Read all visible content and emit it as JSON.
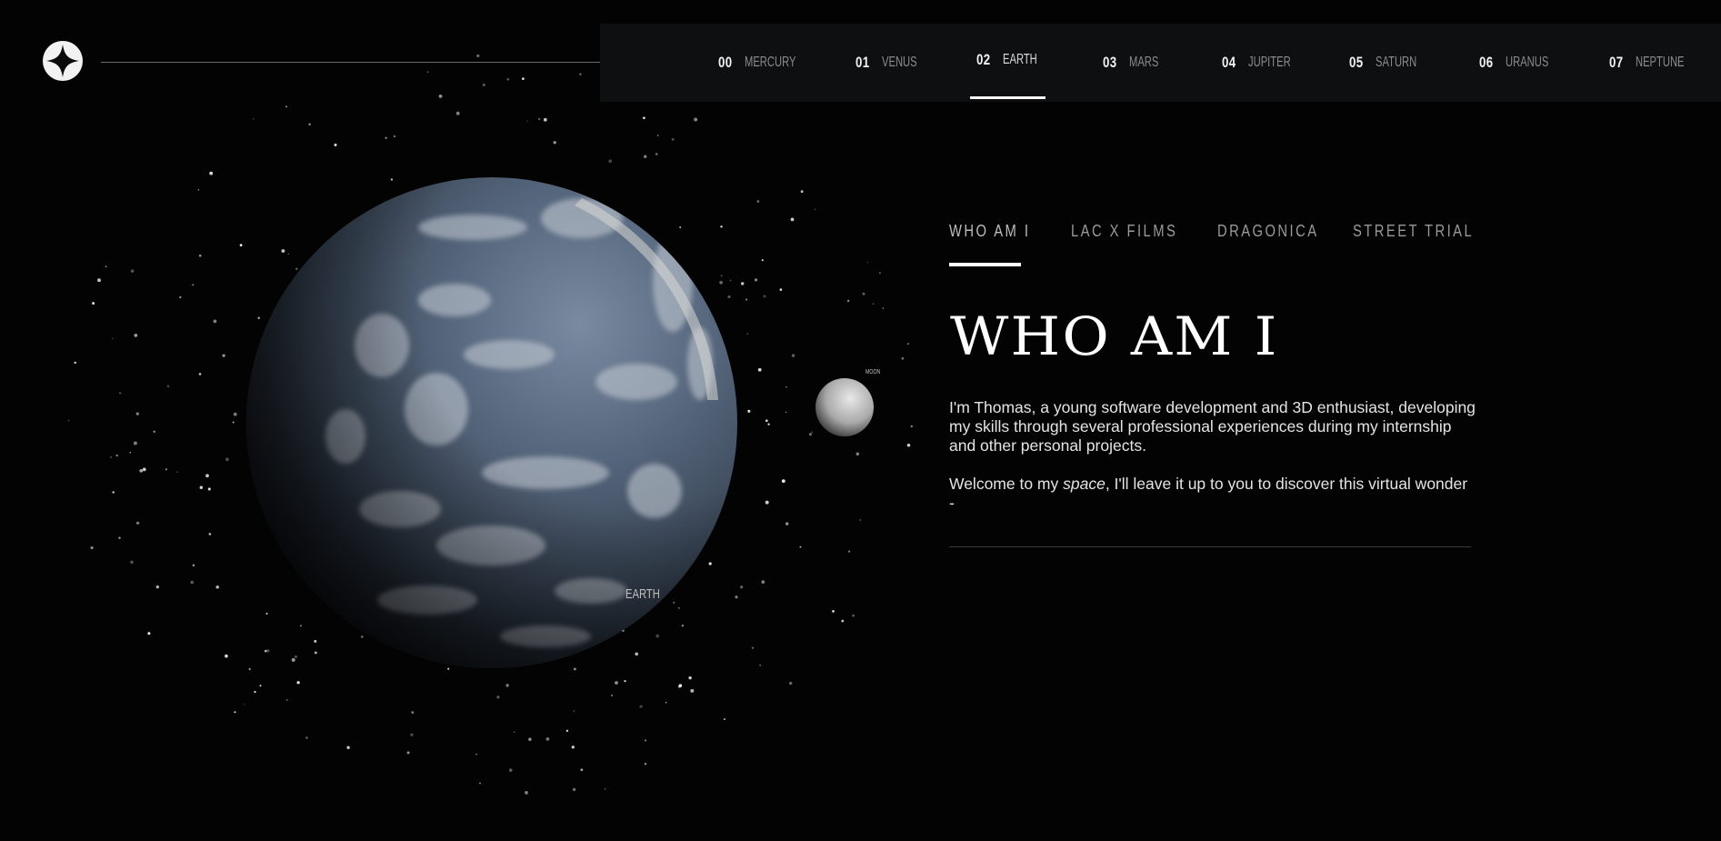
{
  "brand": {
    "logo_icon": "four-point-star-icon"
  },
  "nav": {
    "items": [
      {
        "num": "00",
        "name": "MERCURY",
        "active": false
      },
      {
        "num": "01",
        "name": "VENUS",
        "active": false
      },
      {
        "num": "02",
        "name": "EARTH",
        "active": true
      },
      {
        "num": "03",
        "name": "MARS",
        "active": false
      },
      {
        "num": "04",
        "name": "JUPITER",
        "active": false
      },
      {
        "num": "05",
        "name": "SATURN",
        "active": false
      },
      {
        "num": "06",
        "name": "URANUS",
        "active": false
      },
      {
        "num": "07",
        "name": "NEPTUNE",
        "active": false
      }
    ]
  },
  "scene": {
    "planet_label": "EARTH",
    "moon_label": "MOON"
  },
  "content": {
    "tabs": [
      {
        "label": "WHO AM I",
        "active": true
      },
      {
        "label": "LAC X FILMS",
        "active": false
      },
      {
        "label": "DRAGONICA",
        "active": false
      },
      {
        "label": "STREET TRIAL",
        "active": false
      }
    ],
    "headline": "WHO AM I",
    "paragraph1": "I'm Thomas, a young software development and 3D enthusiast, developing my skills through several professional experiences during my internship and other personal projects.",
    "paragraph2_before": "Welcome to my ",
    "paragraph2_em": "space",
    "paragraph2_after": ", I'll leave it up to you to discover this virtual wonder -"
  },
  "colors": {
    "background": "#030303",
    "nav_background": "#0e0f10",
    "accent": "#ffffff",
    "muted_text": "#9a9a9a"
  }
}
